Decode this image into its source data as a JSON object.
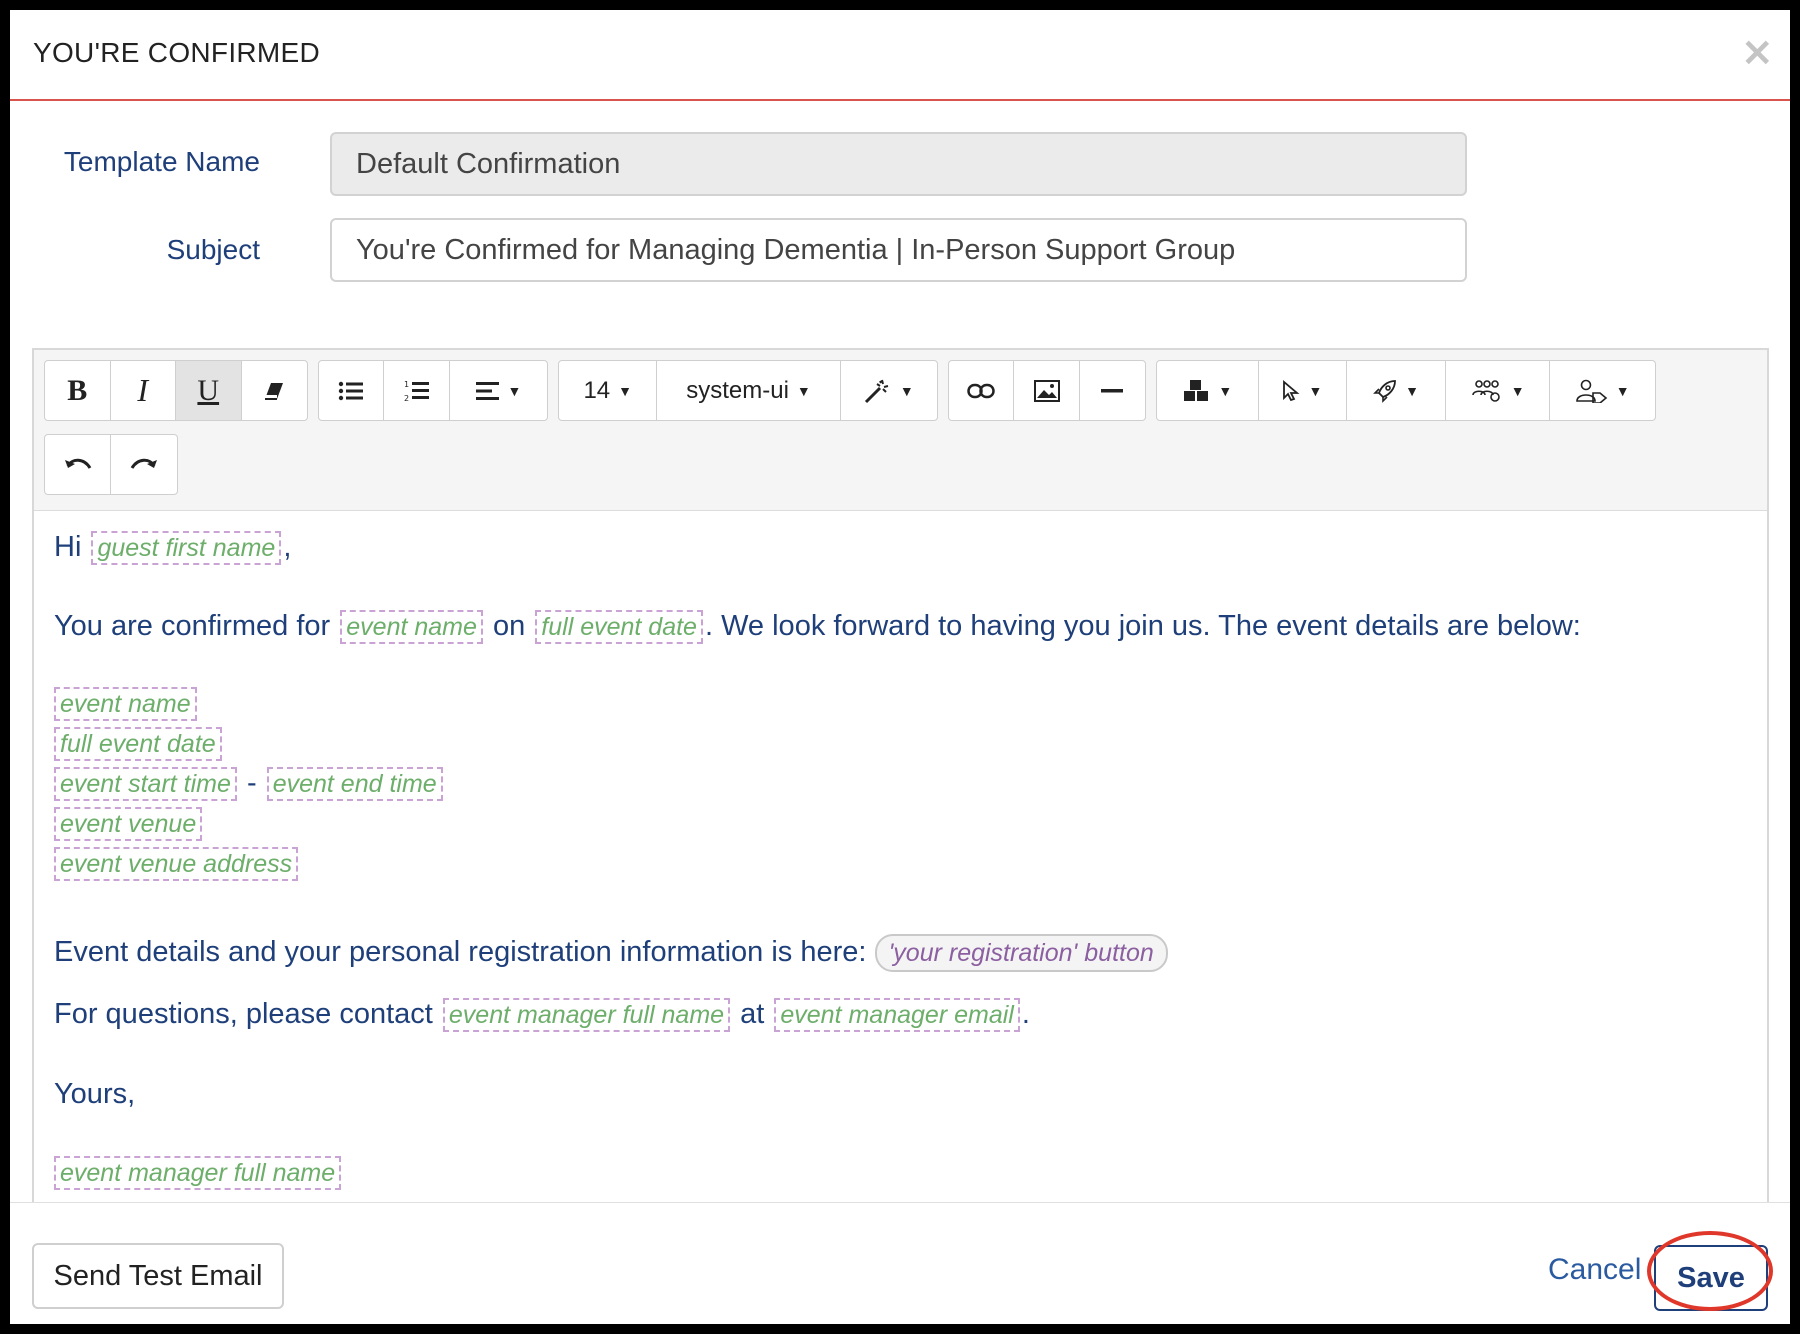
{
  "modal": {
    "title": "YOU'RE CONFIRMED",
    "close_symbol": "×"
  },
  "form": {
    "template_name_label": "Template Name",
    "template_name_value": "Default Confirmation",
    "subject_label": "Subject",
    "subject_value": "You're Confirmed for Managing Dementia | In-Person Support Group"
  },
  "toolbar": {
    "font_size": "14",
    "font_family": "system-ui",
    "icons": [
      "bold-icon",
      "italic-icon",
      "underline-icon",
      "eraser-icon",
      "bullet-list-icon",
      "numbered-list-icon",
      "align-icon",
      "magic-wand-icon",
      "link-icon",
      "image-icon",
      "horizontal-rule-icon",
      "blocks-icon",
      "pointer-icon",
      "rocket-icon",
      "people-icon",
      "user-tag-icon",
      "undo-icon",
      "redo-icon"
    ]
  },
  "body": {
    "greeting": "Hi",
    "greeting_tag": "guest first name",
    "comma": ",",
    "confirm_prefix": "You are confirmed for",
    "confirm_tag1": "event name",
    "confirm_on": "on",
    "confirm_tag2": "full event date",
    "confirm_suffix": ". We look forward to having you join us. The event details are below:",
    "detail_event_name": "event name",
    "detail_full_date": "full event date",
    "detail_start_time": "event start time",
    "detail_dash": "-",
    "detail_end_time": "event end time",
    "detail_venue": "event venue",
    "detail_venue_address": "event venue address",
    "registration_text": "Event details and your personal registration information is here:",
    "registration_button": "'your registration' button",
    "questions_prefix": "For questions, please contact",
    "questions_tag1": "event manager full name",
    "questions_at": "at",
    "questions_tag2": "event manager email",
    "questions_period": ".",
    "closing": "Yours,",
    "signature_tag": "event manager full name"
  },
  "footer": {
    "send_test_label": "Send Test Email",
    "cancel_label": "Cancel",
    "save_label": "Save"
  },
  "colors": {
    "header_rule": "#d9534f",
    "label_text": "#1e3f79",
    "tag_text": "#6cae6a",
    "tag_border": "#c9a3d4",
    "highlight_ring": "#e0372b"
  }
}
